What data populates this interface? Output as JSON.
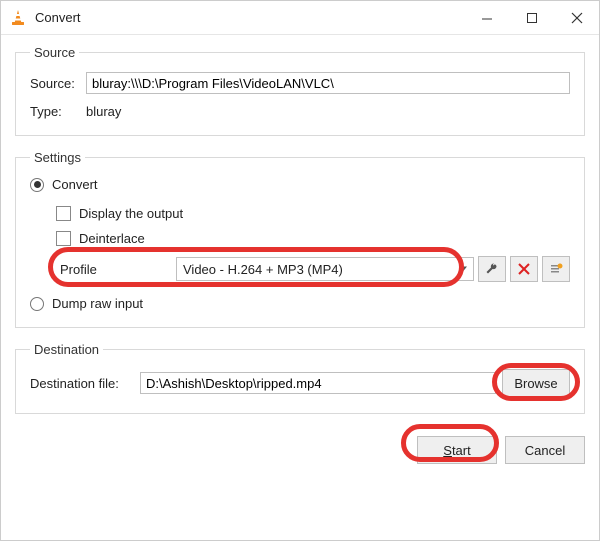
{
  "window": {
    "title": "Convert"
  },
  "source": {
    "legend": "Source",
    "source_label": "Source:",
    "source_value": "bluray:\\\\\\D:\\Program Files\\VideoLAN\\VLC\\",
    "type_label": "Type:",
    "type_value": "bluray"
  },
  "settings": {
    "legend": "Settings",
    "convert_label": "Convert",
    "display_output_label": "Display the output",
    "deinterlace_label": "Deinterlace",
    "profile_label": "Profile",
    "profile_value": "Video - H.264 + MP3 (MP4)",
    "dump_label": "Dump raw input"
  },
  "destination": {
    "legend": "Destination",
    "file_label": "Destination file:",
    "file_value": "D:\\Ashish\\Desktop\\ripped.mp4",
    "browse_label": "Browse"
  },
  "footer": {
    "start_label": "Start",
    "cancel_label": "Cancel"
  }
}
